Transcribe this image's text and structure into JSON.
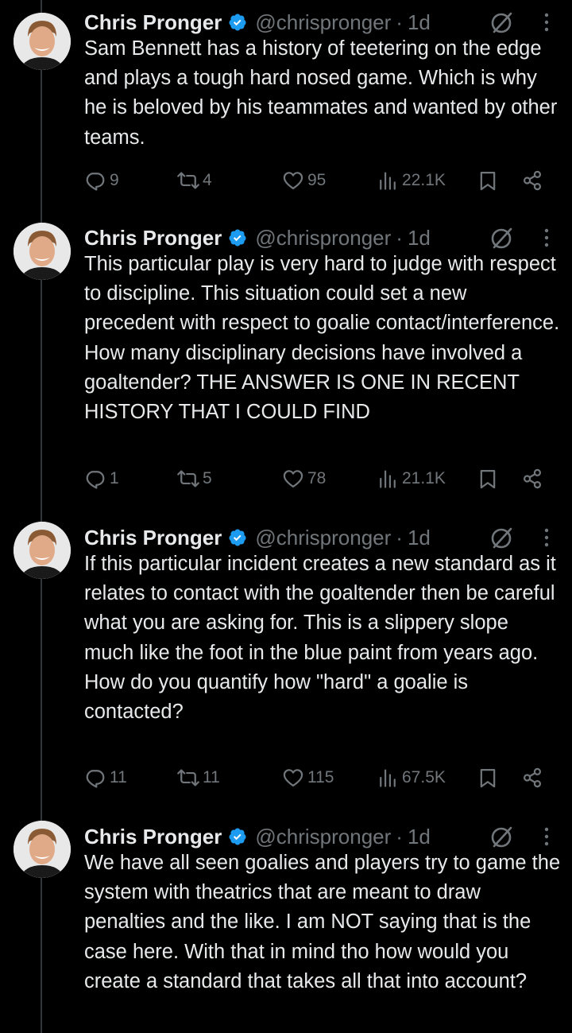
{
  "author": {
    "name": "Chris Pronger",
    "handle": "@chrispronger",
    "separator": "·",
    "time": "1d"
  },
  "colors": {
    "background": "#000000",
    "text": "#e7e9ea",
    "secondary": "#71767b",
    "verified": "#1d9bf0",
    "thread_line": "#333639"
  },
  "icons": {
    "verified": "verified-badge-icon",
    "grok": "grok-icon",
    "more": "more-options-icon",
    "reply": "reply-icon",
    "repost": "repost-icon",
    "like": "like-icon",
    "views": "views-icon",
    "bookmark": "bookmark-icon",
    "share": "share-icon"
  },
  "tweets": [
    {
      "text": "Sam Bennett has a history of teetering on the edge and plays a tough hard nosed game. Which is why he is beloved by his teammates and wanted by other teams.",
      "replies": "9",
      "reposts": "4",
      "likes": "95",
      "views": "22.1K"
    },
    {
      "text": "This particular play is very hard to judge with respect to discipline. This situation could set a new precedent with respect to goalie contact/interference. How many disciplinary decisions have involved a goaltender? THE ANSWER IS ONE IN RECENT HISTORY THAT I COULD FIND",
      "replies": "1",
      "reposts": "5",
      "likes": "78",
      "views": "21.1K"
    },
    {
      "text": "If this particular incident creates a new standard as it relates to contact with the goaltender then be careful what you are asking for. This is a slippery slope much like the foot in the blue paint from years ago. How do you quantify how \"hard\" a goalie is contacted?",
      "replies": "11",
      "reposts": "11",
      "likes": "115",
      "views": "67.5K"
    },
    {
      "text": "We have all seen goalies and players try to game the system with theatrics that are meant to draw penalties and the like. I am NOT saying that is the case here. With that in mind tho how would you create a standard that takes all that into account?"
    }
  ]
}
